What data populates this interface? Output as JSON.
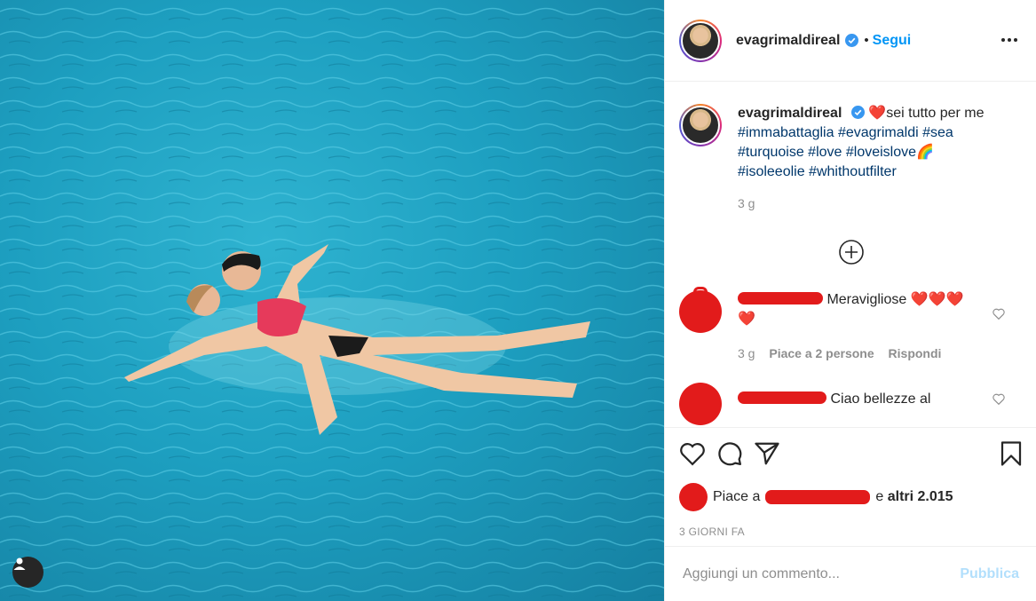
{
  "post": {
    "username": "evagrimaldireal",
    "separator": "•",
    "follow_label": "Segui",
    "caption": {
      "username": "evagrimaldireal",
      "heart_emoji": "❤️",
      "text": "sei tutto per me",
      "hashtags_line1": "#immabattaglia #evagrimaldi #sea",
      "hashtags_line2": "#turquoise #love #loveislove",
      "rainbow_emoji": "🌈",
      "hashtags_line3": "#isoleeolie #whithoutfilter"
    },
    "caption_time": "3 g"
  },
  "comments": [
    {
      "text": "Meravigliose",
      "hearts": "❤️❤️❤️❤️",
      "time": "3 g",
      "likes_label": "Piace a 2 persone",
      "reply_label": "Rispondi"
    },
    {
      "text": "Ciao bellezze al"
    }
  ],
  "likes": {
    "prefix": "Piace a",
    "suffix_plain": "e",
    "suffix_bold": "altri 2.015"
  },
  "date_label": "3 GIORNI FA",
  "add_comment": {
    "placeholder": "Aggiungi un commento...",
    "post_label": "Pubblica"
  },
  "colors": {
    "accent": "#0095f6",
    "redaction": "#e21b1b",
    "water": "#1d9fc0"
  }
}
